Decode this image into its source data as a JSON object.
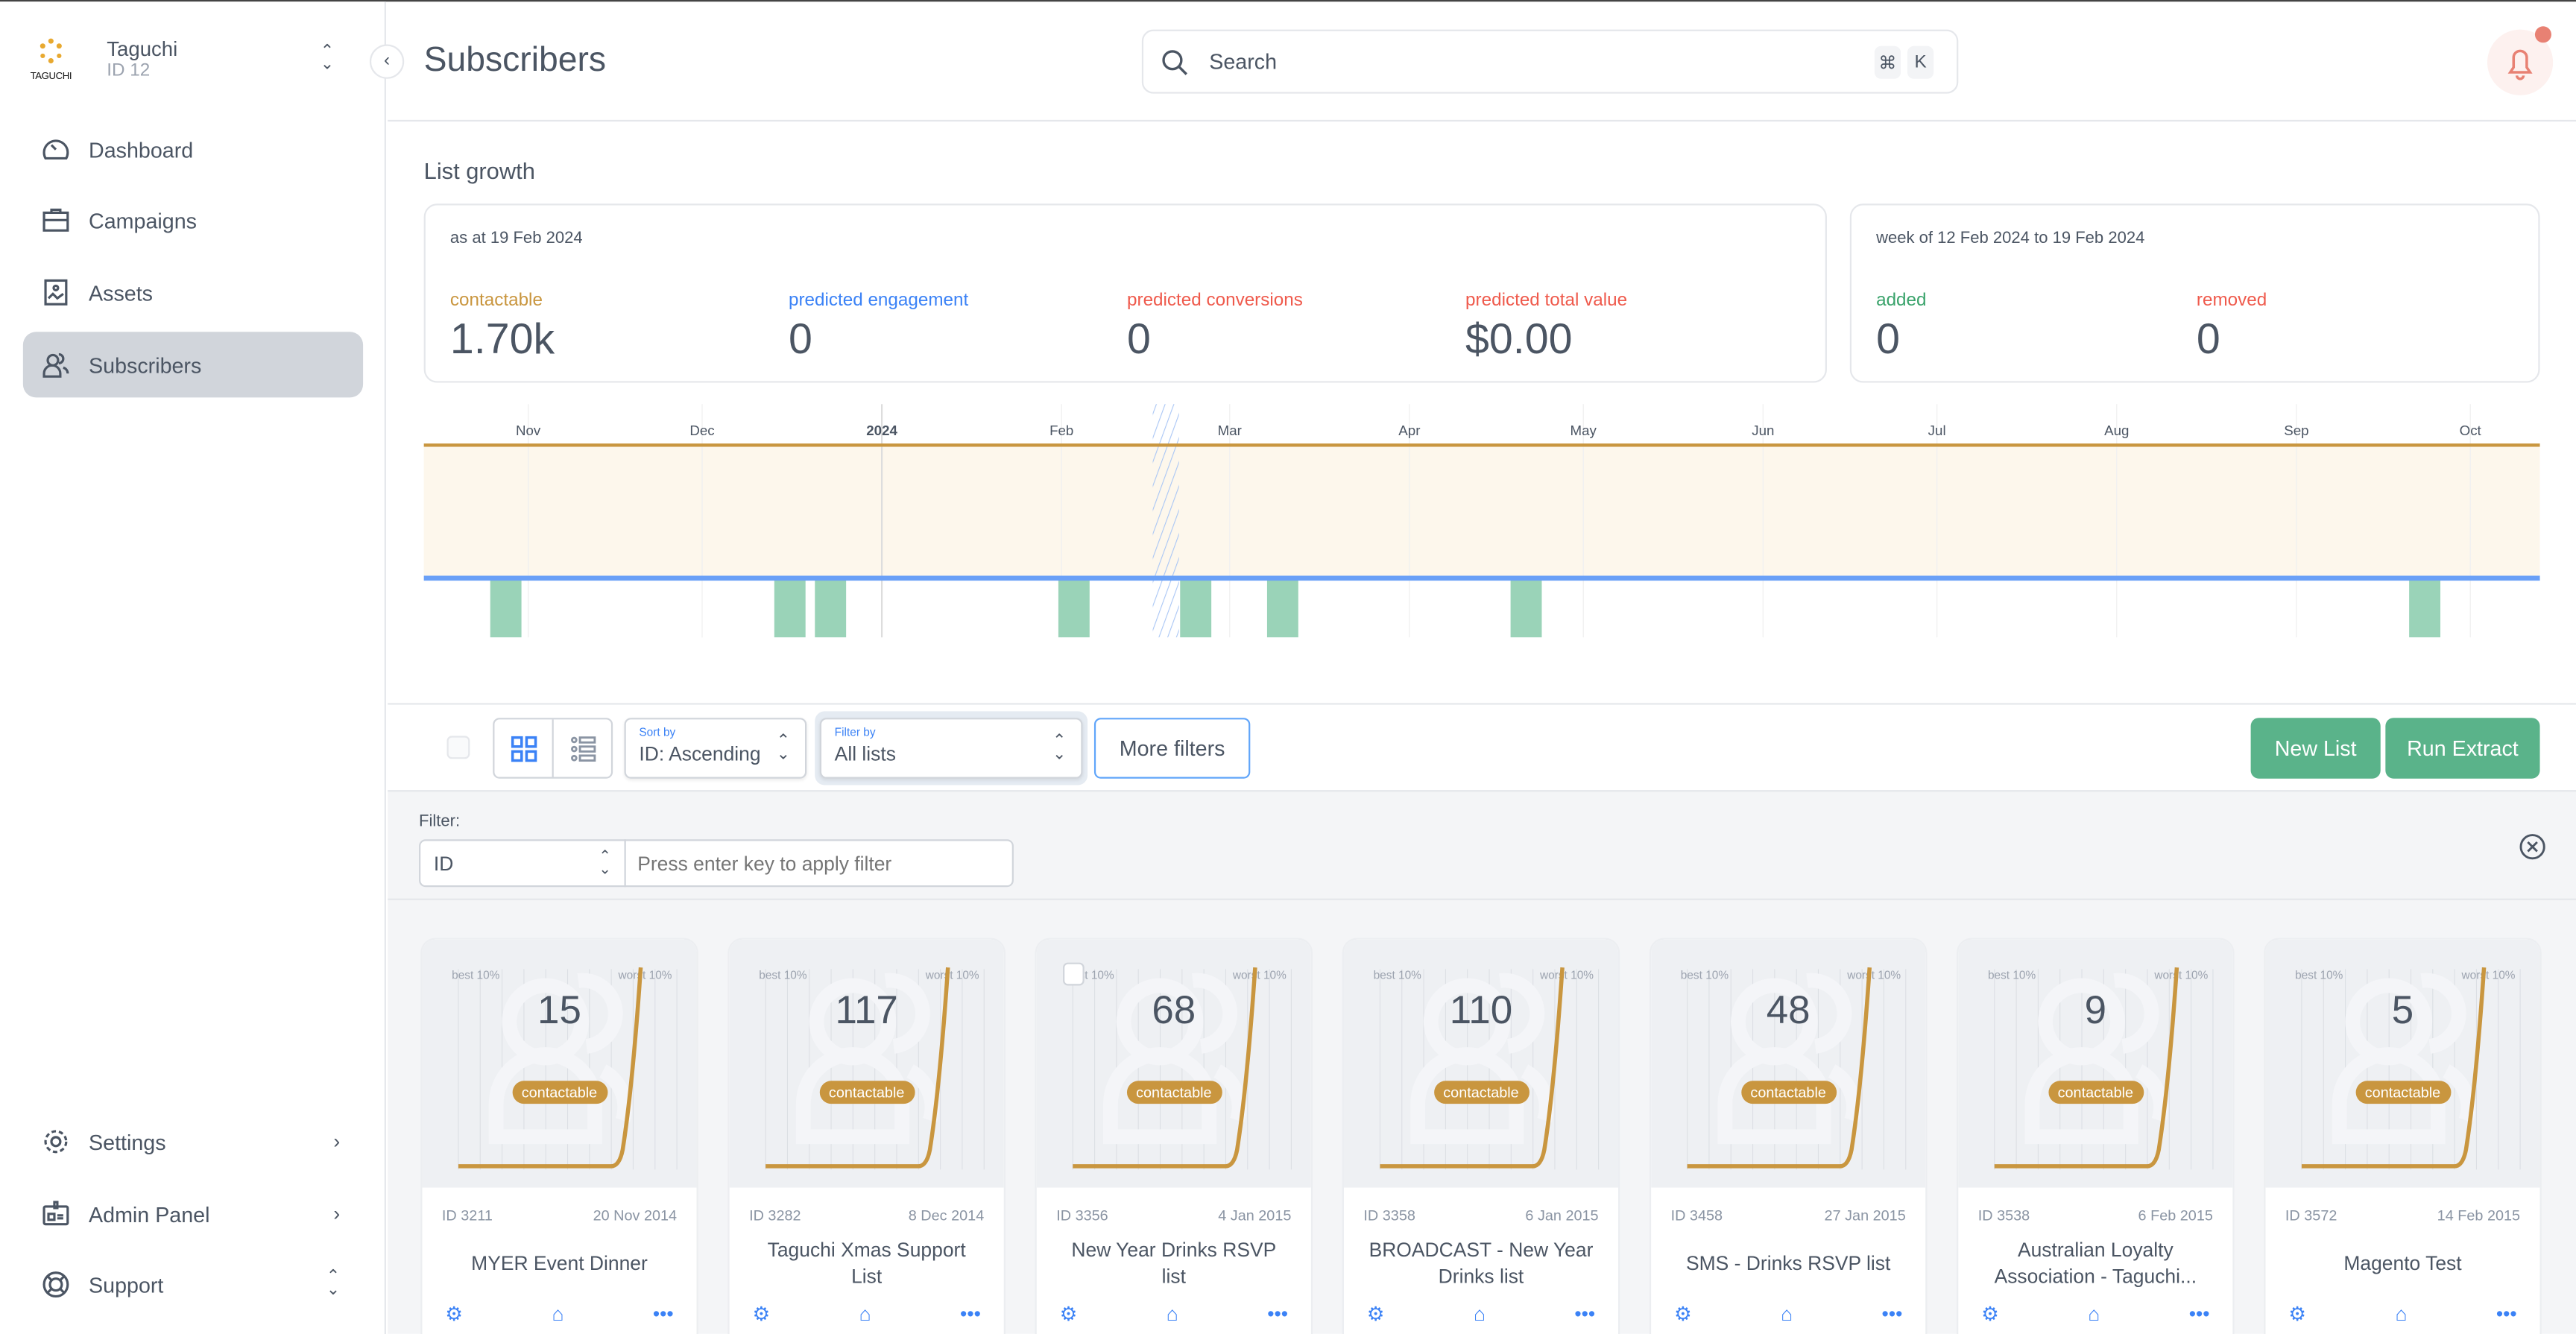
{
  "account": {
    "name": "Taguchi",
    "id": "ID 12",
    "logo_text": "TAGUCHI"
  },
  "sidebar": {
    "items": [
      {
        "label": "Dashboard",
        "icon": "dashboard-gauge-icon"
      },
      {
        "label": "Campaigns",
        "icon": "briefcase-icon"
      },
      {
        "label": "Assets",
        "icon": "image-icon"
      },
      {
        "label": "Subscribers",
        "icon": "users-icon",
        "active": true
      }
    ],
    "bottom": [
      {
        "label": "Settings",
        "icon": "gear-icon"
      },
      {
        "label": "Admin Panel",
        "icon": "id-badge-icon"
      },
      {
        "label": "Support",
        "icon": "lifebuoy-icon"
      }
    ]
  },
  "header": {
    "title": "Subscribers",
    "search_placeholder": "Search",
    "shortcut": [
      "⌘",
      "K"
    ],
    "notification_color": "#e88173"
  },
  "growth": {
    "title": "List growth",
    "snapshot": {
      "date_label": "as at 19 Feb 2024",
      "stats": [
        {
          "label": "contactable",
          "value": "1.70k",
          "color": "#c9963f"
        },
        {
          "label": "predicted engagement",
          "value": "0",
          "color": "#3b82f6"
        },
        {
          "label": "predicted conversions",
          "value": "0",
          "color": "#ef5a4c"
        },
        {
          "label": "predicted total value",
          "value": "$0.00",
          "color": "#ef5a4c"
        }
      ]
    },
    "week": {
      "date_label": "week of 12 Feb 2024 to 19 Feb 2024",
      "stats": [
        {
          "label": "added",
          "value": "0",
          "color": "#3aa36b"
        },
        {
          "label": "removed",
          "value": "0",
          "color": "#ef5a4c"
        }
      ]
    }
  },
  "chart_data": {
    "type": "area",
    "x_ticks": [
      "Nov",
      "Dec",
      "2024",
      "Feb",
      "Mar",
      "Apr",
      "May",
      "Jun",
      "Jul",
      "Aug",
      "Sep",
      "Oct"
    ],
    "xlim": [
      "2023-10-14",
      "2024-10-13"
    ],
    "grid": true,
    "current_week": "2024-02-19",
    "series": [
      {
        "name": "contactable",
        "type": "area",
        "color": "#c9963f",
        "fill": "#fdf7ec",
        "x": [
          "2023-10-14",
          "2024-10-13"
        ],
        "y": [
          1700,
          1700
        ]
      },
      {
        "name": "added",
        "type": "bar",
        "color": "#9ad3b8",
        "weeks": [
          "2023-10-28",
          "2023-12-16",
          "2023-12-23",
          "2024-02-03",
          "2024-02-24",
          "2024-03-10",
          "2024-04-21",
          "2024-09-23"
        ]
      }
    ],
    "baseline_color": "#6aa0f7"
  },
  "toolbar": {
    "sort": {
      "label": "Sort by",
      "value": "ID: Ascending"
    },
    "filter": {
      "label": "Filter by",
      "value": "All lists"
    },
    "more_filters": "More filters",
    "new_list": "New List",
    "run_extract": "Run Extract",
    "filter_row": {
      "label": "Filter:",
      "field": "ID",
      "placeholder": "Press enter key to apply filter"
    }
  },
  "cards_meta": {
    "best": "best 10%",
    "worst": "worst 10%",
    "pill": "contactable"
  },
  "cards": [
    {
      "count": "15",
      "id": "ID 3211",
      "date": "20 Nov 2014",
      "name": "MYER Event Dinner"
    },
    {
      "count": "117",
      "id": "ID 3282",
      "date": "8 Dec 2014",
      "name": "Taguchi Xmas Support List"
    },
    {
      "count": "68",
      "id": "ID 3356",
      "date": "4 Jan 2015",
      "name": "New Year Drinks RSVP list"
    },
    {
      "count": "110",
      "id": "ID 3358",
      "date": "6 Jan 2015",
      "name": "BROADCAST - New Year Drinks list"
    },
    {
      "count": "48",
      "id": "ID 3458",
      "date": "27 Jan 2015",
      "name": "SMS - Drinks RSVP list"
    },
    {
      "count": "9",
      "id": "ID 3538",
      "date": "6 Feb 2015",
      "name": "Australian Loyalty Association - Taguchi..."
    },
    {
      "count": "5",
      "id": "ID 3572",
      "date": "14 Feb 2015",
      "name": "Magento Test"
    }
  ]
}
